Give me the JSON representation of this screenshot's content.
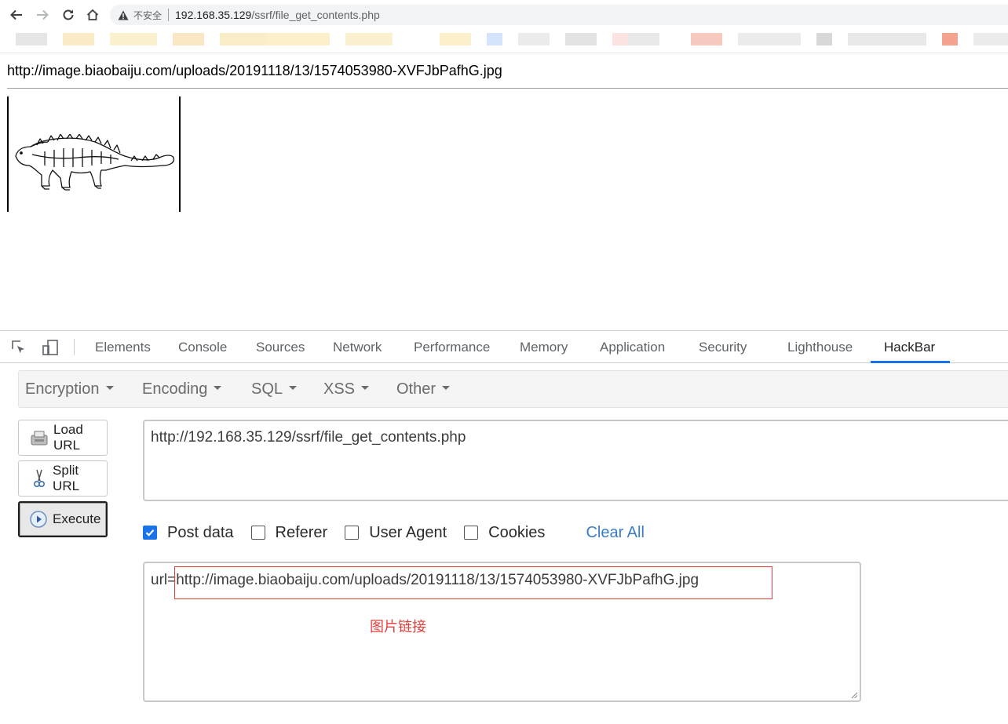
{
  "browser": {
    "security_label": "不安全",
    "url_host": "192.168.35.129",
    "url_path": "/ssrf/file_get_contents.php"
  },
  "page": {
    "response_text": "http://image.biaobaiju.com/uploads/20191118/13/1574053980-XVFJbPafhG.jpg"
  },
  "devtools": {
    "tabs": [
      "Elements",
      "Console",
      "Sources",
      "Network",
      "Performance",
      "Memory",
      "Application",
      "Security",
      "Lighthouse",
      "HackBar"
    ],
    "active_tab": "HackBar"
  },
  "hackbar": {
    "menu": [
      "Encryption",
      "Encoding",
      "SQL",
      "XSS",
      "Other"
    ],
    "buttons": {
      "load_url": "Load URL",
      "split_url": "Split URL",
      "execute": "Execute"
    },
    "url_value": "http://192.168.35.129/ssrf/file_get_contents.php",
    "options": [
      {
        "label": "Post data",
        "checked": true
      },
      {
        "label": "Referer",
        "checked": false
      },
      {
        "label": "User Agent",
        "checked": false
      },
      {
        "label": "Cookies",
        "checked": false
      }
    ],
    "clear_all": "Clear All",
    "post_data": "url=http://image.biaobaiju.com/uploads/20191118/13/1574053980-XVFJbPafhG.jpg"
  },
  "annotation": {
    "note": "图片链接",
    "color": "#e0403c"
  }
}
